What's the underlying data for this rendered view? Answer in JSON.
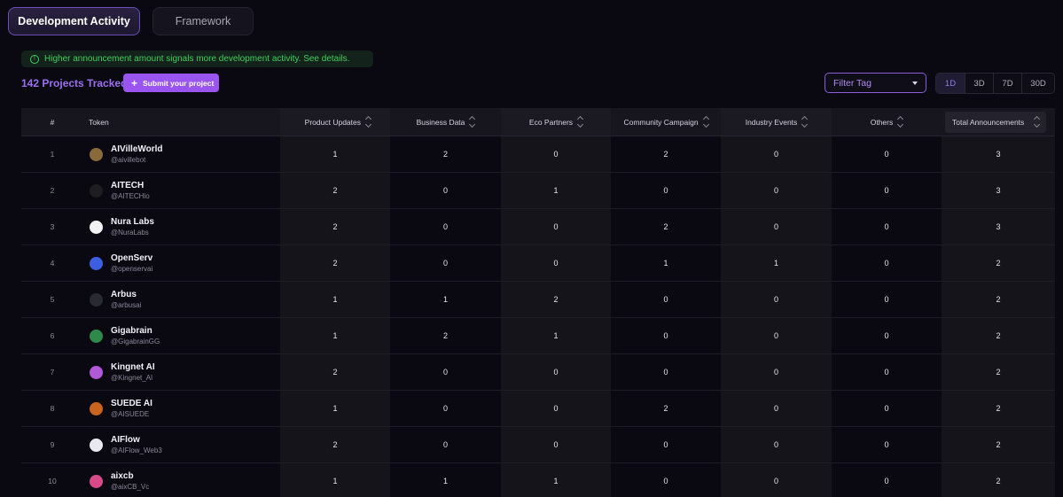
{
  "tabs": [
    {
      "label": "Development Activity",
      "active": true
    },
    {
      "label": "Framework",
      "active": false
    }
  ],
  "notice": {
    "icon": "info-circle-icon",
    "text": "Higher announcement amount signals more development activity. See details.",
    "color": "#3fcf5f"
  },
  "tracked": "142 Projects Tracked",
  "submit_button": {
    "icon": "plus-icon",
    "label": "Submit your project"
  },
  "filter": {
    "label": "Filter Tag",
    "icon": "caret-down-icon"
  },
  "periods": [
    {
      "label": "1D",
      "active": true
    },
    {
      "label": "3D",
      "active": false
    },
    {
      "label": "7D",
      "active": false
    },
    {
      "label": "30D",
      "active": false
    }
  ],
  "columns": [
    "#",
    "Token",
    "Product Updates",
    "Business Data",
    "Eco Partners",
    "Community Campaign",
    "Industry Events",
    "Others",
    "Total Announcements"
  ],
  "rows": [
    {
      "rank": "1",
      "name": "AIVilleWorld",
      "handle": "@aivillebot",
      "avatar_color": "#8a6a3a",
      "values": [
        "1",
        "2",
        "0",
        "2",
        "0",
        "0",
        "3"
      ]
    },
    {
      "rank": "2",
      "name": "AITECH",
      "handle": "@AITECHio",
      "avatar_color": "#1e1e22",
      "values": [
        "2",
        "0",
        "1",
        "0",
        "0",
        "0",
        "3"
      ]
    },
    {
      "rank": "3",
      "name": "Nura Labs",
      "handle": "@NuraLabs",
      "avatar_color": "#f2f2f2",
      "values": [
        "2",
        "0",
        "0",
        "2",
        "0",
        "0",
        "3"
      ]
    },
    {
      "rank": "4",
      "name": "OpenServ",
      "handle": "@openservai",
      "avatar_color": "#3b5fe0",
      "values": [
        "2",
        "0",
        "0",
        "1",
        "1",
        "0",
        "2"
      ]
    },
    {
      "rank": "5",
      "name": "Arbus",
      "handle": "@arbusai",
      "avatar_color": "#2a2a33",
      "values": [
        "1",
        "1",
        "2",
        "0",
        "0",
        "0",
        "2"
      ]
    },
    {
      "rank": "6",
      "name": "Gigabrain",
      "handle": "@GigabrainGG",
      "avatar_color": "#2f8a4a",
      "values": [
        "1",
        "2",
        "1",
        "0",
        "0",
        "0",
        "2"
      ]
    },
    {
      "rank": "7",
      "name": "Kingnet AI",
      "handle": "@Kingnet_AI",
      "avatar_color": "#b05ad8",
      "values": [
        "2",
        "0",
        "0",
        "0",
        "0",
        "0",
        "2"
      ]
    },
    {
      "rank": "8",
      "name": "SUEDE AI",
      "handle": "@AISUEDE",
      "avatar_color": "#c8641e",
      "values": [
        "1",
        "0",
        "0",
        "2",
        "0",
        "0",
        "2"
      ]
    },
    {
      "rank": "9",
      "name": "AIFlow",
      "handle": "@AIFlow_Web3",
      "avatar_color": "#e8e8ee",
      "values": [
        "2",
        "0",
        "0",
        "0",
        "0",
        "0",
        "2"
      ]
    },
    {
      "rank": "10",
      "name": "aixcb",
      "handle": "@aixCB_Vc",
      "avatar_color": "#d84a8a",
      "values": [
        "1",
        "1",
        "1",
        "0",
        "0",
        "0",
        "2"
      ]
    }
  ]
}
